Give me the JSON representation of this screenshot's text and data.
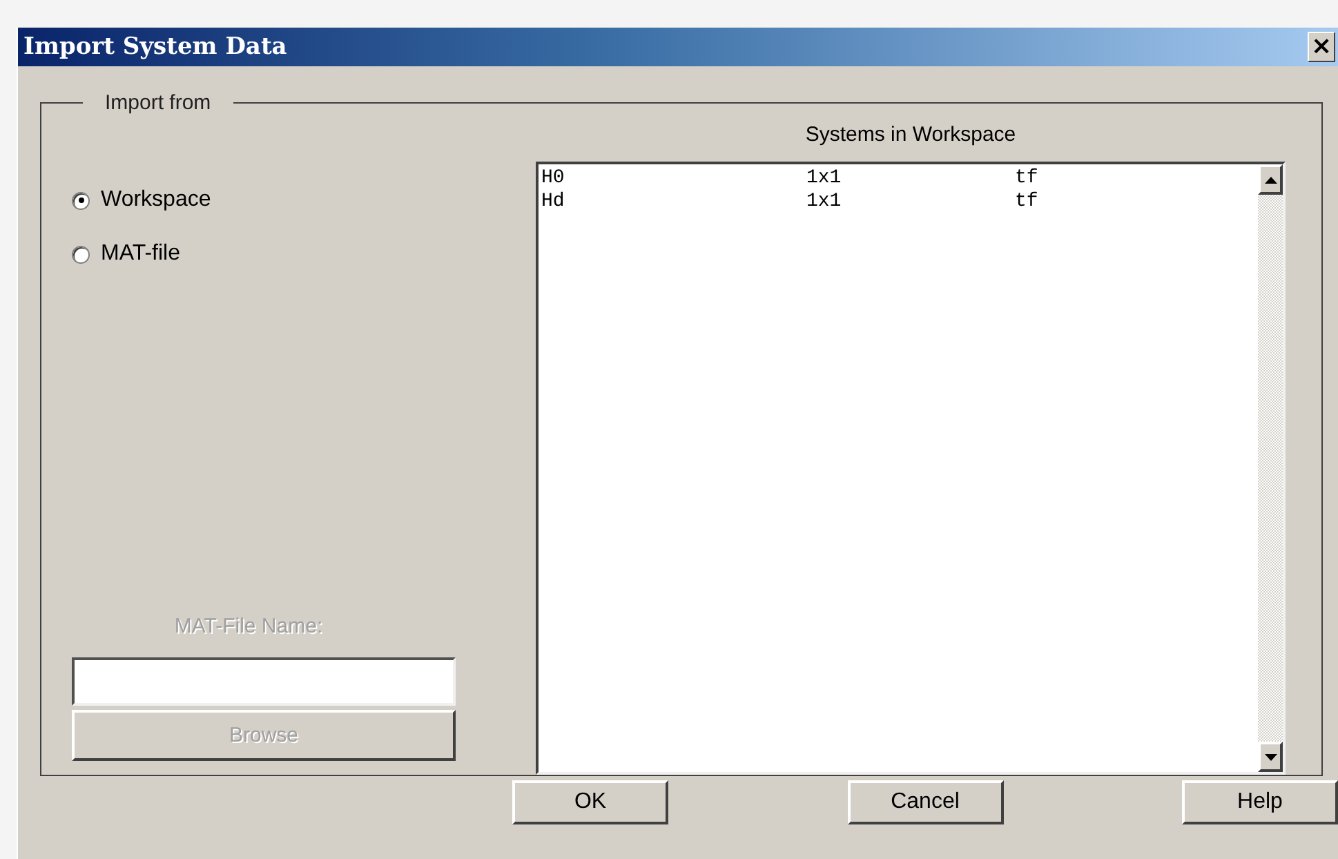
{
  "window": {
    "title": "Import System Data",
    "close": "×"
  },
  "group": {
    "legend": "Import from"
  },
  "sources": [
    {
      "label": "Workspace",
      "selected": true
    },
    {
      "label": "MAT-file",
      "selected": false
    }
  ],
  "mat_file": {
    "label": "MAT-File Name:",
    "disabled": true,
    "browse": "Browse"
  },
  "systems": {
    "heading": "Systems in Workspace",
    "rows": [
      {
        "name": "H0",
        "size": "1x1",
        "type": "tf"
      },
      {
        "name": "Hd",
        "size": "1x1",
        "type": "tf"
      }
    ]
  },
  "buttons": [
    "OK",
    "Cancel",
    "Help"
  ]
}
